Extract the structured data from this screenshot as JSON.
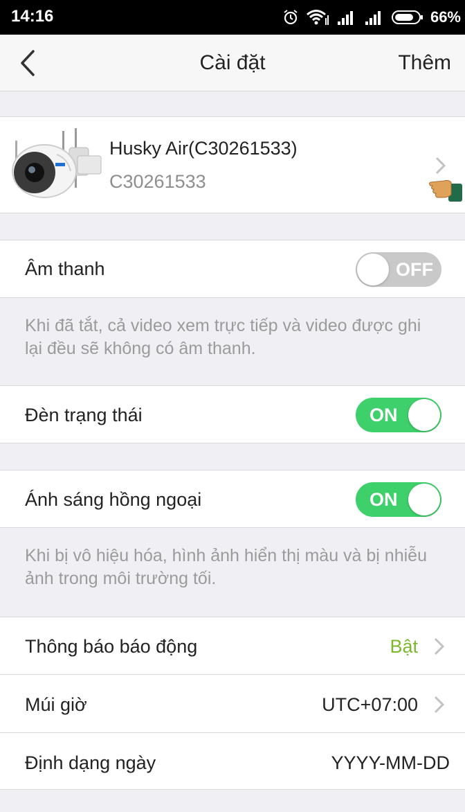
{
  "status_bar": {
    "time": "14:16",
    "battery": "66%",
    "icons": [
      "alarm-icon",
      "wifi-icon",
      "signal-icon",
      "signal-icon",
      "battery-icon"
    ]
  },
  "nav": {
    "back_icon": "chevron-left-icon",
    "title": "Cài đặt",
    "action": "Thêm"
  },
  "device": {
    "name": "Husky Air(C30261533)",
    "serial": "C30261533"
  },
  "settings": {
    "sound": {
      "label": "Âm thanh",
      "state": "OFF",
      "note": "Khi đã tắt, cả video xem trực tiếp và video được ghi lại đều sẽ không có âm thanh."
    },
    "status_light": {
      "label": "Đèn trạng thái",
      "state": "ON"
    },
    "infrared": {
      "label": "Ánh sáng hồng ngoại",
      "state": "ON",
      "note": "Khi bị vô hiệu hóa, hình ảnh hiển thị màu và bị nhiễu ảnh trong môi trường tối."
    },
    "alarm_notification": {
      "label": "Thông báo báo động",
      "value": "Bật"
    },
    "timezone": {
      "label": "Múi giờ",
      "value": "UTC+07:00"
    },
    "date_format": {
      "label": "Định dạng ngày",
      "value": "YYYY-MM-DD"
    }
  },
  "colors": {
    "toggle_on": "#3ed06a",
    "toggle_off": "#c9c9c9",
    "accent_value": "#7cb82f",
    "note_text": "#9b9b9b"
  }
}
